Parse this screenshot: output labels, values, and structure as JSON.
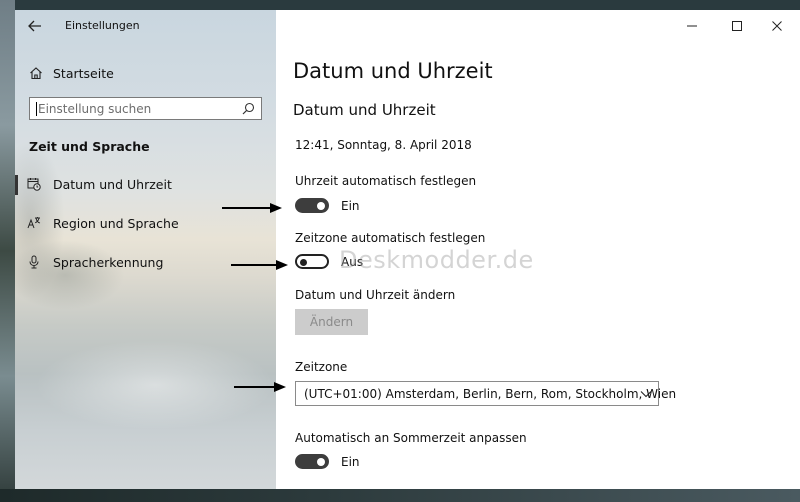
{
  "window": {
    "app_title": "Einstellungen",
    "controls": [
      "minimize-icon",
      "maximize-icon",
      "close-icon"
    ]
  },
  "sidebar": {
    "home_label": "Startseite",
    "search": {
      "placeholder": "Einstellung suchen"
    },
    "section_heading": "Zeit und Sprache",
    "items": [
      {
        "label": "Datum und Uhrzeit",
        "icon": "calendar-clock-icon",
        "selected": true
      },
      {
        "label": "Region und Sprache",
        "icon": "language-icon",
        "selected": false
      },
      {
        "label": "Spracherkennung",
        "icon": "microphone-icon",
        "selected": false
      }
    ]
  },
  "main": {
    "page_title": "Datum und Uhrzeit",
    "section_title": "Datum und Uhrzeit",
    "current_datetime": "12:41, Sonntag, 8. April 2018",
    "auto_time": {
      "label": "Uhrzeit automatisch festlegen",
      "state": "Ein",
      "on": true
    },
    "auto_timezone": {
      "label": "Zeitzone automatisch festlegen",
      "state": "Aus",
      "on": false
    },
    "change_datetime": {
      "label": "Datum und Uhrzeit ändern",
      "button": "Ändern",
      "enabled": false
    },
    "timezone": {
      "label": "Zeitzone",
      "value": "(UTC+01:00) Amsterdam, Berlin, Bern, Rom, Stockholm, Wien"
    },
    "dst": {
      "label": "Automatisch an Sommerzeit anpassen",
      "state": "Ein",
      "on": true
    }
  },
  "watermark": "Deskmodder.de",
  "colors": {
    "toggle_on": "#3d3d3d",
    "button_disabled": "#cccccc"
  }
}
